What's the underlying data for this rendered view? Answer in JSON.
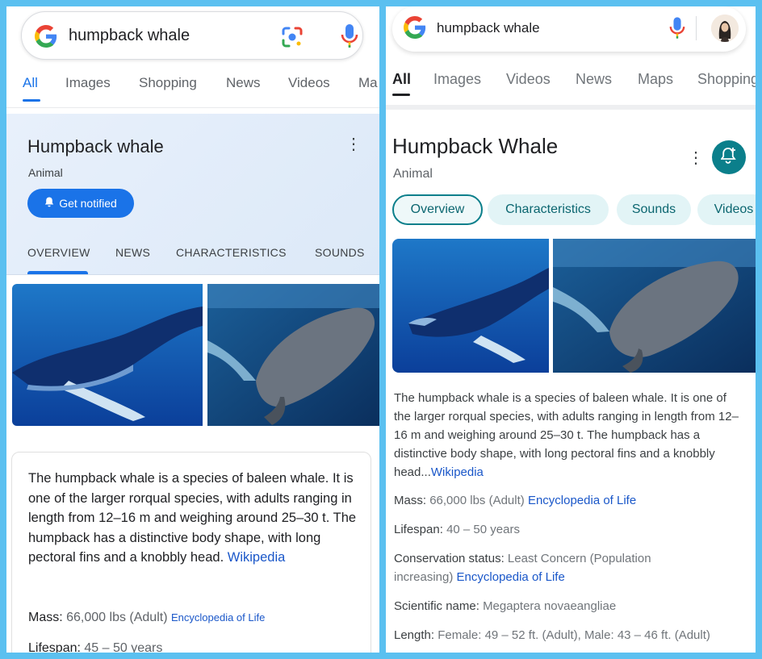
{
  "left": {
    "search": {
      "query": "humpback whale"
    },
    "tabs": [
      "All",
      "Images",
      "Shopping",
      "News",
      "Videos",
      "Ma"
    ],
    "entity": {
      "title": "Humpback whale",
      "subtitle": "Animal",
      "notify_label": "Get notified"
    },
    "subtabs": [
      "OVERVIEW",
      "NEWS",
      "CHARACTERISTICS",
      "SOUNDS"
    ],
    "description": "The humpback whale is a species of baleen whale. It is one of the larger rorqual species, with adults ranging in length from 12–16 m and weighing around 25–30 t. The humpback has a distinctive body shape, with long pectoral fins and a knobbly head.",
    "description_source": "Wikipedia",
    "facts": [
      {
        "label": "Mass:",
        "value": "66,000 lbs (Adult)",
        "source": "Encyclopedia of Life"
      },
      {
        "label": "Lifespan:",
        "value": "45 – 50 years",
        "source": ""
      }
    ]
  },
  "right": {
    "search": {
      "query": "humpback whale"
    },
    "tabs": [
      "All",
      "Images",
      "Videos",
      "News",
      "Maps",
      "Shopping"
    ],
    "entity": {
      "title": "Humpback Whale",
      "subtitle": "Animal"
    },
    "chips": [
      "Overview",
      "Characteristics",
      "Sounds",
      "Videos"
    ],
    "description": "The humpback whale is a species of baleen whale. It is one of the larger rorqual species, with adults ranging in length from 12–16 m and weighing around 25–30 t. The humpback has a distinctive body shape, with long pectoral fins and a knobbly head...",
    "description_source": "Wikipedia",
    "facts": [
      {
        "label": "Mass:",
        "value": "66,000 lbs (Adult)",
        "source": "Encyclopedia of Life"
      },
      {
        "label": "Lifespan:",
        "value": "40 – 50 years",
        "source": ""
      },
      {
        "label": "Conservation status:",
        "value": "Least Concern (Population increasing)",
        "source": "Encyclopedia of Life"
      },
      {
        "label": "Scientific name:",
        "value": "Megaptera novaeangliae",
        "source": ""
      },
      {
        "label": "Length:",
        "value": "Female: 49 – 52 ft. (Adult), Male: 43 – 46 ft. (Adult)",
        "source": ""
      }
    ]
  },
  "icons": {
    "google_logo": "google-g-logo",
    "lens": "google-lens-icon",
    "mic": "microphone-icon",
    "bell": "bell-icon",
    "more": "more-vert-icon",
    "avatar": "user-avatar"
  },
  "colors": {
    "frame": "#5bc0f0",
    "blue_accent": "#1a73e8",
    "teal_accent": "#0b7f8b",
    "link": "#1a57c9"
  }
}
